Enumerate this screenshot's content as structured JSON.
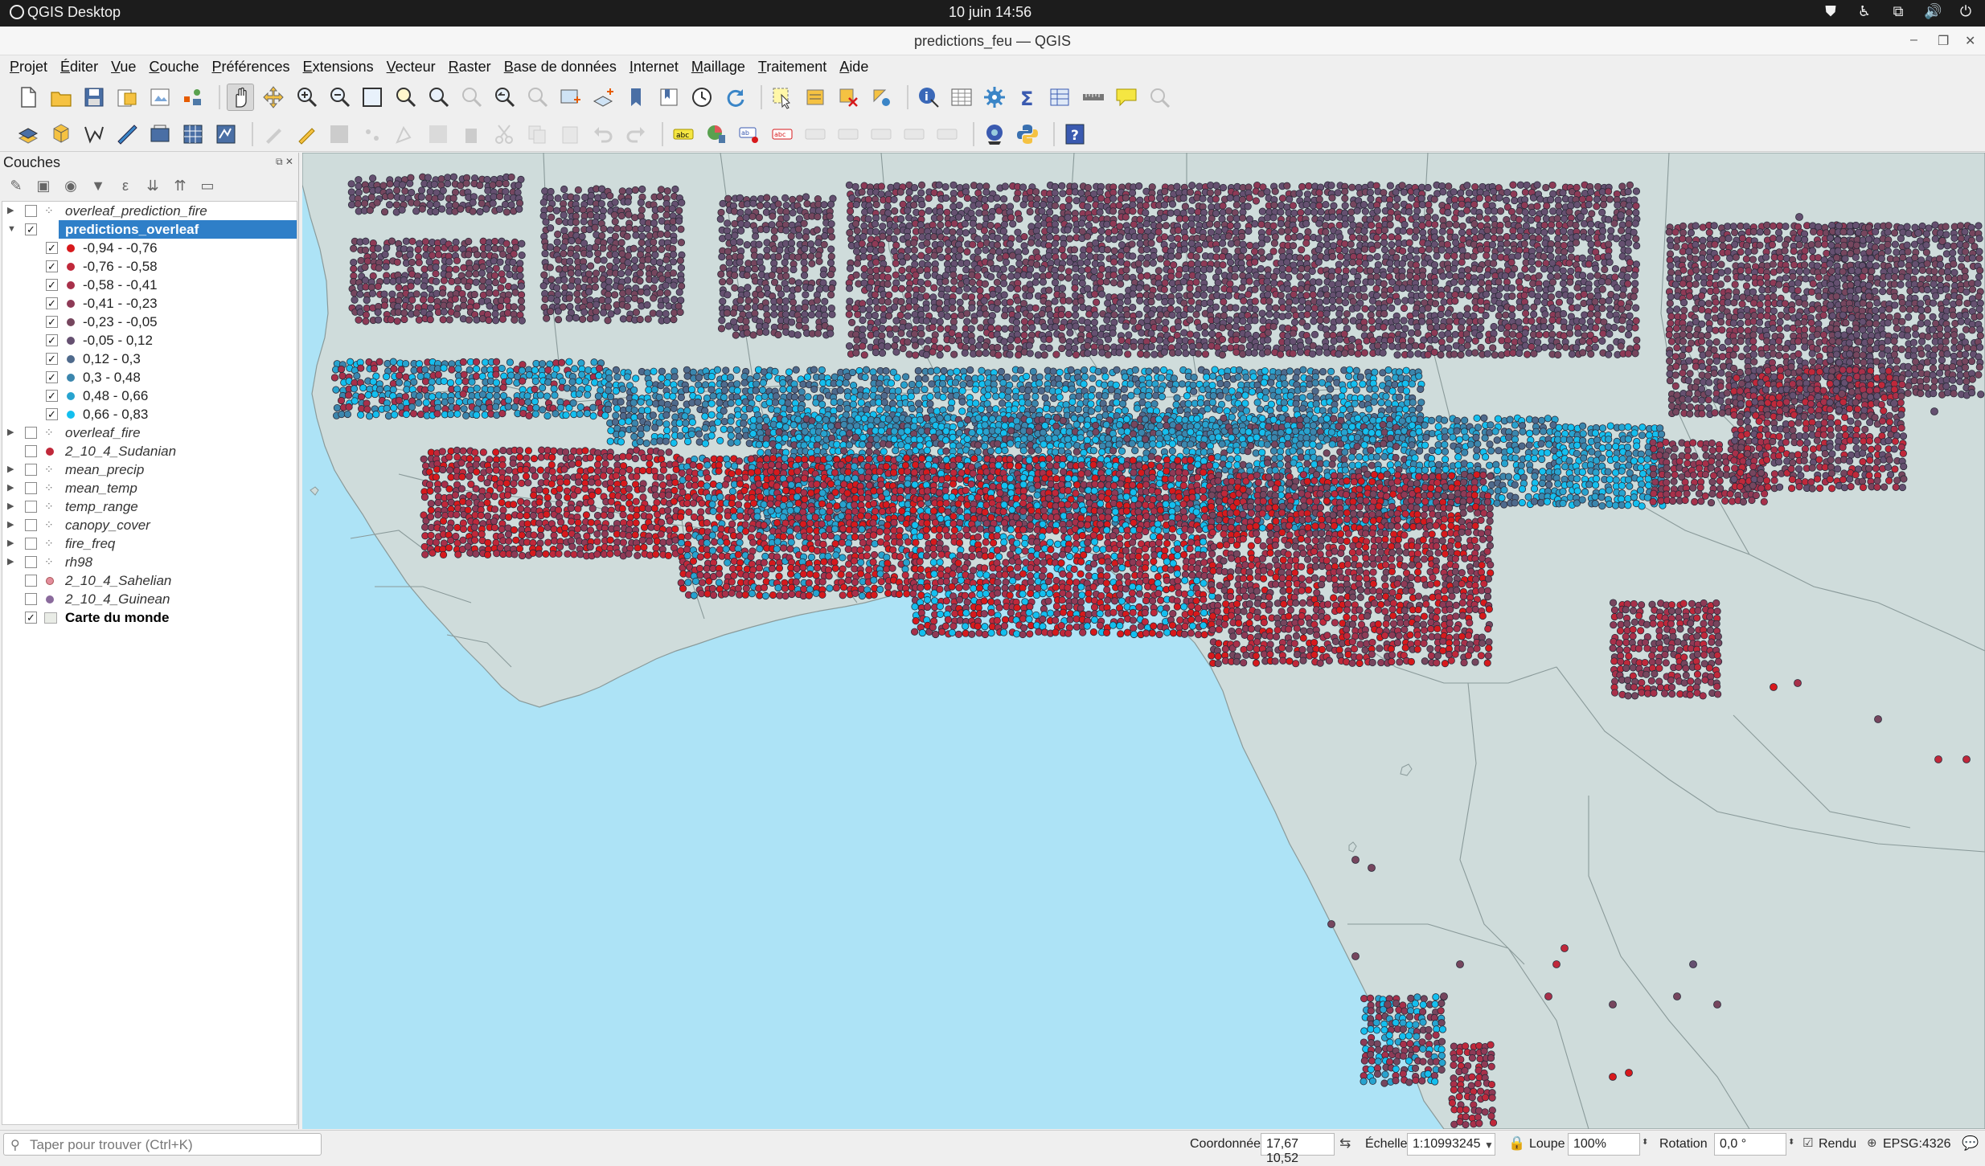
{
  "system": {
    "app_name": "QGIS Desktop",
    "clock": "10 juin  14:56"
  },
  "window": {
    "title": "predictions_feu — QGIS"
  },
  "menu": [
    "Projet",
    "Éditer",
    "Vue",
    "Couche",
    "Préférences",
    "Extensions",
    "Vecteur",
    "Raster",
    "Base de données",
    "Internet",
    "Maillage",
    "Traitement",
    "Aide"
  ],
  "layers_panel": {
    "title": "Couches",
    "layers": [
      {
        "name": "overleaf_prediction_fire",
        "checked": false
      },
      {
        "name": "predictions_overleaf",
        "checked": true,
        "selected": true
      },
      {
        "name": "overleaf_fire",
        "checked": false
      },
      {
        "name": "2_10_4_Sudanian",
        "checked": false
      },
      {
        "name": "mean_precip",
        "checked": false
      },
      {
        "name": "mean_temp",
        "checked": false
      },
      {
        "name": "temp_range",
        "checked": false
      },
      {
        "name": "canopy_cover",
        "checked": false
      },
      {
        "name": "fire_freq",
        "checked": false
      },
      {
        "name": "rh98",
        "checked": false
      },
      {
        "name": "2_10_4_Sahelian",
        "checked": false
      },
      {
        "name": "2_10_4_Guinean",
        "checked": false
      },
      {
        "name": "Carte du monde",
        "checked": true
      }
    ],
    "legend_classes": [
      {
        "label": "-0,94 - -0,76",
        "color": "#d7191c"
      },
      {
        "label": "-0,76 - -0,58",
        "color": "#c0283a"
      },
      {
        "label": "-0,58 - -0,41",
        "color": "#a8304a"
      },
      {
        "label": "-0,41 - -0,23",
        "color": "#8e3a56"
      },
      {
        "label": "-0,23 - -0,05",
        "color": "#76465e"
      },
      {
        "label": "-0,05 - 0,12",
        "color": "#655070"
      },
      {
        "label": "0,12 - 0,3",
        "color": "#4f6a8c"
      },
      {
        "label": "0,3 - 0,48",
        "color": "#3b86ad"
      },
      {
        "label": "0,48 - 0,66",
        "color": "#27a3cf"
      },
      {
        "label": "0,66 - 0,83",
        "color": "#13bfef"
      }
    ]
  },
  "status": {
    "locator_placeholder": "Taper pour trouver (Ctrl+K)",
    "coord_label": "Coordonnée",
    "coord_value": "17,67 10,52",
    "scale_label": "Échelle",
    "scale_value": "1:10993245",
    "magnifier_label": "Loupe",
    "magnifier_value": "100%",
    "rotation_label": "Rotation",
    "rotation_value": "0,0 °",
    "render_label": "Rendu",
    "crs": "EPSG:4326"
  },
  "colors": {
    "sea": "#ade3f6",
    "land": "#cfdcdb",
    "border": "#8a9a9a",
    "selection": "#2f7fc8"
  }
}
